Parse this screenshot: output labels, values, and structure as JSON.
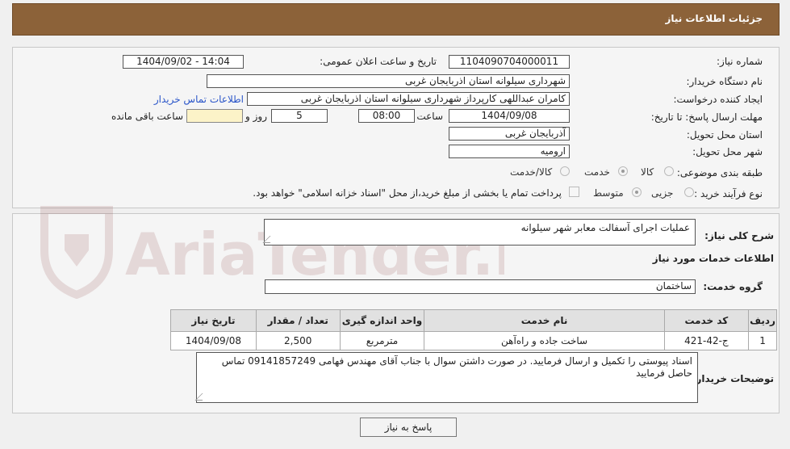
{
  "header": {
    "title": "جزئیات اطلاعات نیاز"
  },
  "watermark": {
    "text": "AriaTender.neT"
  },
  "form": {
    "need_number_label": "شماره نیاز:",
    "need_number": "1104090704000011",
    "announce_label": "تاریخ و ساعت اعلان عمومی:",
    "announce_value": "1404/09/02 - 14:04",
    "buyer_label": "نام دستگاه خریدار:",
    "buyer_value": "شهرداری سیلوانه استان اذربایجان غربی",
    "creator_label": "ایجاد کننده درخواست:",
    "creator_value": "کامران عبداللهی کارپرداز شهرداری سیلوانه استان اذربایجان غربی",
    "contact_link": "اطلاعات تماس خریدار",
    "deadline_label": "مهلت ارسال پاسخ: تا تاریخ:",
    "deadline_date": "1404/09/08",
    "time_label": "ساعت",
    "deadline_time": "08:00",
    "days_value": "5",
    "days_label": "روز و",
    "remaining_label": "ساعت باقی مانده",
    "province_label": "استان محل تحویل:",
    "province_value": "آذربایجان غربی",
    "city_label": "شهر محل تحویل:",
    "city_value": "ارومیه",
    "category_label": "طبقه بندی موضوعی:",
    "category_options": [
      "کالا",
      "خدمت",
      "کالا/خدمت"
    ],
    "category_selected": "خدمت",
    "process_label": "نوع فرآیند خرید :",
    "process_options": [
      "جزیی",
      "متوسط"
    ],
    "process_selected": "متوسط",
    "payment_note": "پرداخت تمام یا بخشی از مبلغ خرید،از محل \"اسناد خزانه اسلامی\" خواهد بود."
  },
  "details": {
    "summary_label": "شرح کلی نیاز:",
    "summary_value": "عملیات اجرای آسفالت معابر شهر سیلوانه",
    "services_heading": "اطلاعات خدمات مورد نیاز",
    "service_group_label": "گروه خدمت:",
    "service_group_value": "ساختمان",
    "table": {
      "headers": [
        "ردیف",
        "کد خدمت",
        "نام خدمت",
        "واحد اندازه گیری",
        "تعداد / مقدار",
        "تاریخ نیاز"
      ],
      "rows": [
        [
          "1",
          "ج-42-421",
          "ساخت جاده و راه‌آهن",
          "مترمربع",
          "2,500",
          "1404/09/08"
        ]
      ]
    },
    "buyer_notes_label": "توضیحات خریدار:",
    "buyer_notes_value": "اسناد پیوستی را تکمیل و ارسال فرمایید. در صورت داشتن سوال با جناب آقای مهندس فهامی  09141857249 تماس حاصل فرمایید",
    "reply_button": "پاسخ به نیاز"
  }
}
